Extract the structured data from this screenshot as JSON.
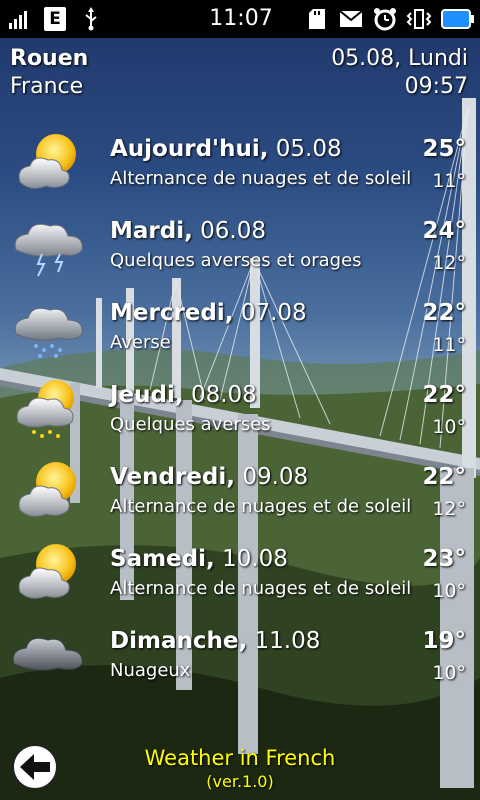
{
  "status_bar": {
    "time": "11:07",
    "network_badge": "E",
    "icons": [
      "signal-icon",
      "edge-icon",
      "usb-icon",
      "sd-card-icon",
      "mail-icon",
      "alarm-icon",
      "vibrate-icon",
      "battery-icon"
    ]
  },
  "location": {
    "city": "Rouen",
    "country": "France"
  },
  "current": {
    "date": "05.08, Lundi",
    "time": "09:57"
  },
  "forecast": [
    {
      "day": "Aujourd'hui,",
      "date": "05.08",
      "description": "Alternance de nuages et de soleil",
      "max": "25°",
      "min": "11°",
      "icon": "partly-cloudy-icon"
    },
    {
      "day": "Mardi,",
      "date": "06.08",
      "description": "Quelques averses et orages",
      "max": "24°",
      "min": "12°",
      "icon": "thunderstorm-icon"
    },
    {
      "day": "Mercredi,",
      "date": "07.08",
      "description": "Averse",
      "max": "22°",
      "min": "11°",
      "icon": "rain-icon"
    },
    {
      "day": "Jeudi,",
      "date": "08.08",
      "description": "Quelques averses",
      "max": "22°",
      "min": "10°",
      "icon": "sun-showers-icon"
    },
    {
      "day": "Vendredi,",
      "date": "09.08",
      "description": "Alternance de nuages et de soleil",
      "max": "22°",
      "min": "12°",
      "icon": "partly-cloudy-icon"
    },
    {
      "day": "Samedi,",
      "date": "10.08",
      "description": "Alternance de nuages et de soleil",
      "max": "23°",
      "min": "10°",
      "icon": "partly-cloudy-icon"
    },
    {
      "day": "Dimanche,",
      "date": "11.08",
      "description": "Nuageux",
      "max": "19°",
      "min": "10°",
      "icon": "cloudy-icon"
    }
  ],
  "footer": {
    "title": "Weather in French",
    "version": "(ver.1.0)"
  },
  "colors": {
    "footer_text": "#ffff00",
    "text": "#ffffff"
  }
}
